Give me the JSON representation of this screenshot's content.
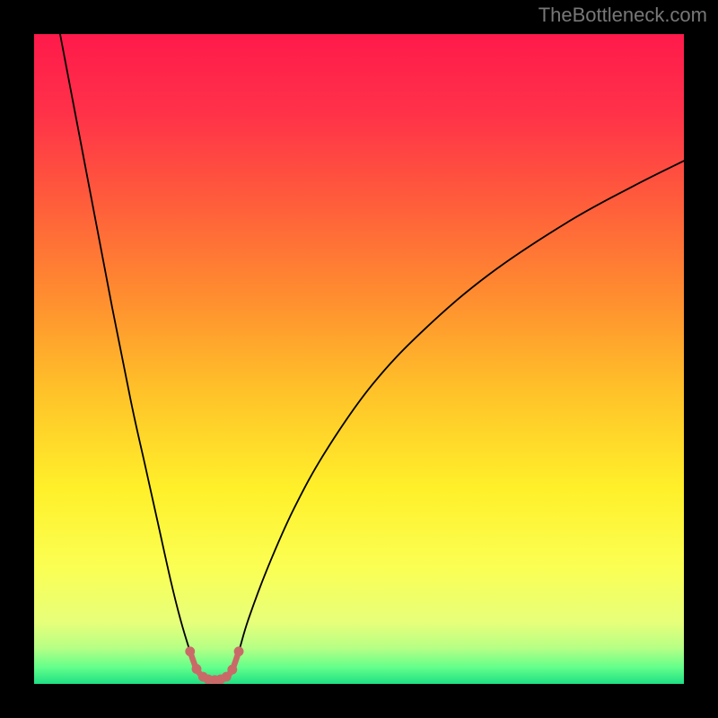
{
  "watermark": "TheBottleneck.com",
  "colors": {
    "frame_bg": "#000000",
    "watermark": "#777777",
    "curve_main": "#000000",
    "curve_bottom": "#c96a68",
    "marker_fill": "#c96a68"
  },
  "gradient_stops": [
    {
      "offset": 0.0,
      "color": "#ff1a4b"
    },
    {
      "offset": 0.12,
      "color": "#ff3149"
    },
    {
      "offset": 0.25,
      "color": "#ff5a3c"
    },
    {
      "offset": 0.4,
      "color": "#ff8c30"
    },
    {
      "offset": 0.55,
      "color": "#ffc229"
    },
    {
      "offset": 0.7,
      "color": "#fff02a"
    },
    {
      "offset": 0.82,
      "color": "#fbff53"
    },
    {
      "offset": 0.905,
      "color": "#e7ff7a"
    },
    {
      "offset": 0.945,
      "color": "#b6ff85"
    },
    {
      "offset": 0.975,
      "color": "#62ff8a"
    },
    {
      "offset": 1.0,
      "color": "#1fdf84"
    }
  ],
  "chart_data": {
    "type": "line",
    "title": "",
    "xlabel": "",
    "ylabel": "",
    "xlim": [
      0,
      100
    ],
    "ylim": [
      0,
      100
    ],
    "series": [
      {
        "name": "curve",
        "x": [
          4,
          8,
          12,
          15,
          17,
          19,
          21,
          22.5,
          24,
          25,
          25.8,
          26.8,
          27.8,
          28.7,
          29.6,
          30.5,
          31.5,
          33,
          36,
          40,
          45,
          52,
          60,
          70,
          82,
          92,
          100
        ],
        "values": [
          100,
          79,
          58,
          43,
          34,
          25,
          16,
          10,
          5,
          2.3,
          1.1,
          0.7,
          0.6,
          0.7,
          1.1,
          2.2,
          5,
          10,
          18,
          27,
          36,
          46,
          54.5,
          63,
          71,
          76.5,
          80.5
        ]
      }
    ],
    "markers": {
      "name": "bottom-markers",
      "x": [
        24.0,
        25.0,
        26.0,
        26.8,
        27.8,
        28.7,
        29.6,
        30.5,
        31.5
      ],
      "values": [
        5.0,
        2.3,
        1.1,
        0.7,
        0.6,
        0.7,
        1.1,
        2.2,
        5.0
      ]
    }
  }
}
